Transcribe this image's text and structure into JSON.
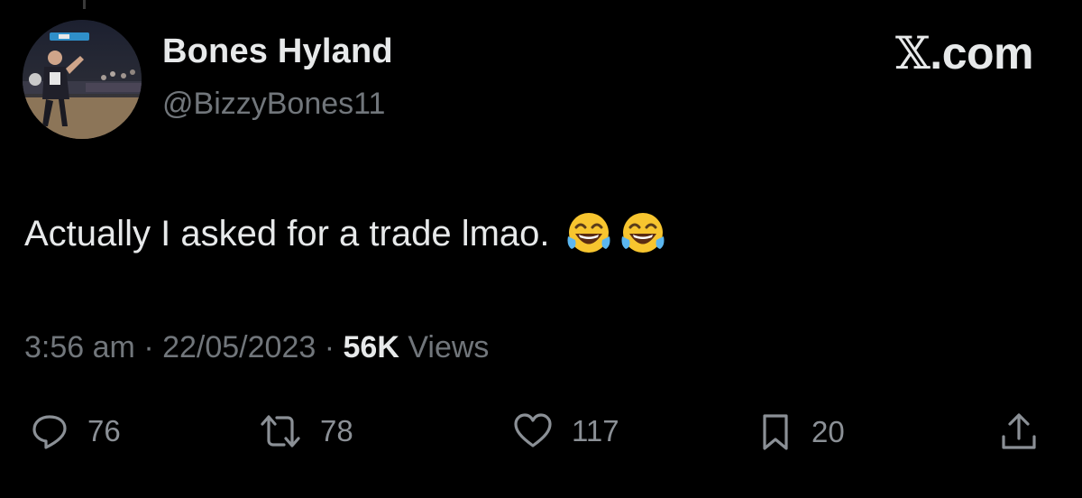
{
  "author": {
    "display_name": "Bones Hyland",
    "handle": "@BizzyBones11",
    "avatar_icon": "avatar-photo-basketball-player"
  },
  "brand": {
    "glyph": "𝕏",
    "suffix": ".com"
  },
  "tweet": {
    "text": "Actually I asked for a trade lmao.",
    "emojis": [
      "face-with-tears-of-joy-icon",
      "face-with-tears-of-joy-icon"
    ]
  },
  "meta": {
    "time": "3:56 am",
    "separator": "·",
    "date": "22/05/2023",
    "views_count": "56K",
    "views_label": "Views"
  },
  "actions": {
    "reply": {
      "icon": "reply-icon",
      "count": "76"
    },
    "repost": {
      "icon": "repost-icon",
      "count": "78"
    },
    "like": {
      "icon": "heart-icon",
      "count": "117"
    },
    "bookmark": {
      "icon": "bookmark-icon",
      "count": "20"
    },
    "share": {
      "icon": "share-icon"
    }
  },
  "colors": {
    "background": "#000000",
    "primary_text": "#e7e9ea",
    "secondary_text": "#71767b",
    "icon": "#8b9096"
  }
}
